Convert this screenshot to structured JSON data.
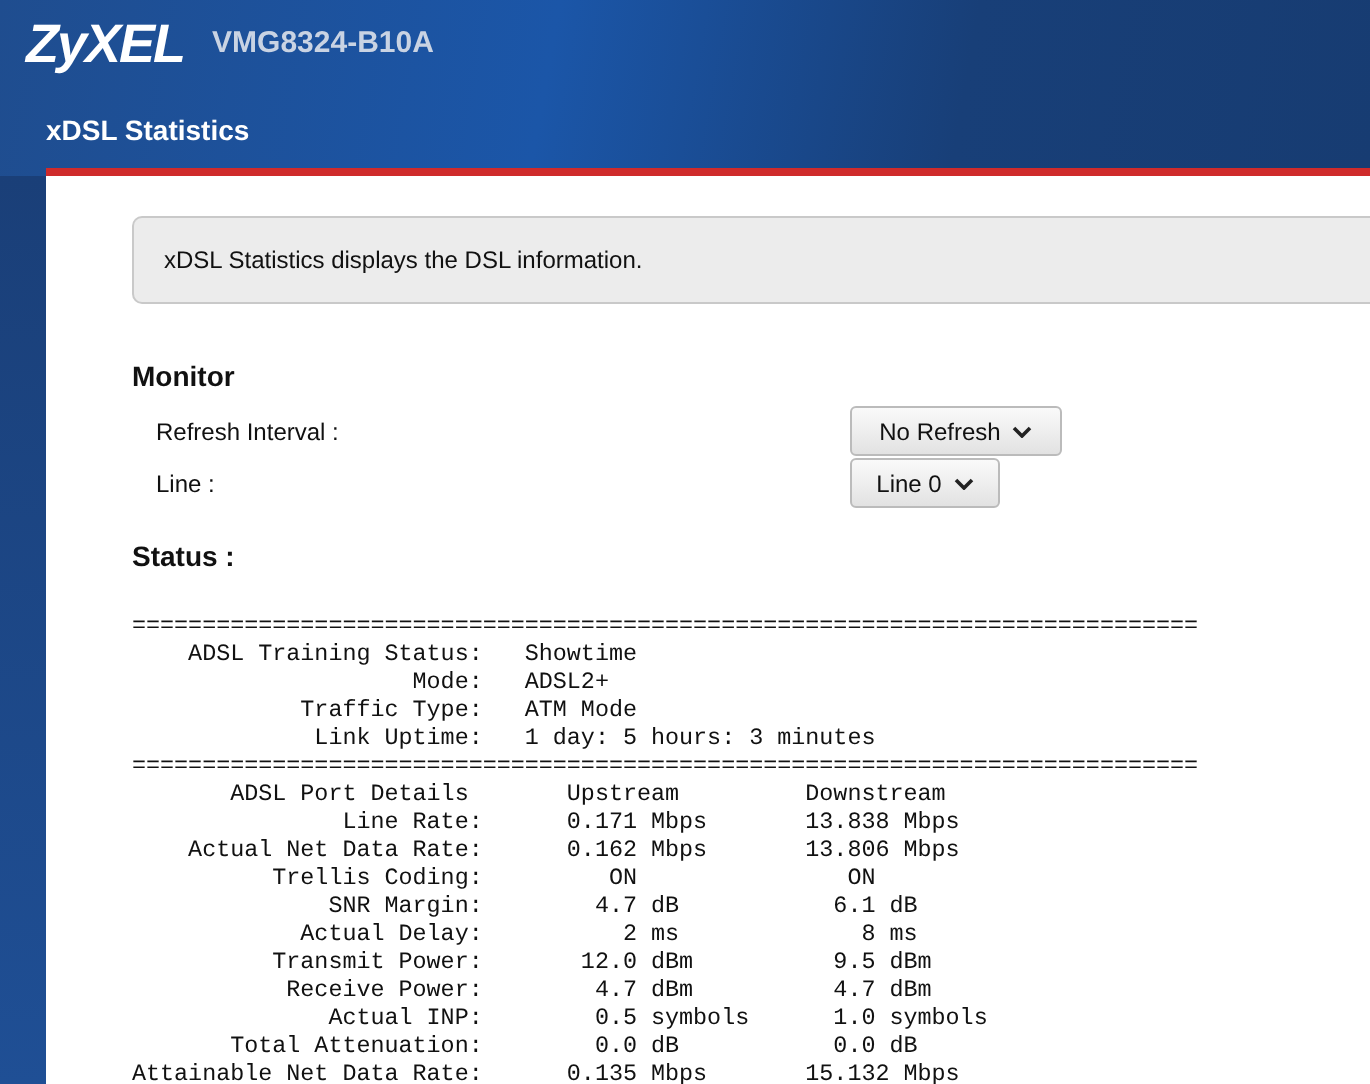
{
  "header": {
    "logo": "ZyXEL",
    "model": "VMG8324-B10A"
  },
  "page_title": "xDSL Statistics",
  "info": "xDSL Statistics displays the DSL information.",
  "monitor": {
    "title": "Monitor",
    "fields": [
      {
        "label": "Refresh Interval :",
        "value": "No Refresh"
      },
      {
        "label": "Line :",
        "value": "Line 0"
      }
    ]
  },
  "status": {
    "title": "Status :",
    "lines": [
      "============================================================================",
      "    ADSL Training Status:   Showtime",
      "                    Mode:   ADSL2+",
      "            Traffic Type:   ATM Mode",
      "             Link Uptime:   1 day: 5 hours: 3 minutes",
      "============================================================================",
      "       ADSL Port Details       Upstream         Downstream",
      "               Line Rate:      0.171 Mbps       13.838 Mbps",
      "    Actual Net Data Rate:      0.162 Mbps       13.806 Mbps",
      "          Trellis Coding:         ON               ON",
      "              SNR Margin:        4.7 dB           6.1 dB",
      "            Actual Delay:          2 ms             8 ms",
      "          Transmit Power:       12.0 dBm          9.5 dBm",
      "           Receive Power:        4.7 dBm          4.7 dBm",
      "              Actual INP:        0.5 symbols      1.0 symbols",
      "       Total Attenuation:        0.0 dB           0.0 dB",
      "Attainable Net Data Rate:      0.135 Mbps       15.132 Mbps"
    ]
  }
}
